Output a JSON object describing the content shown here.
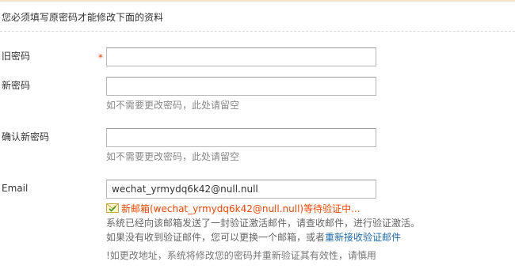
{
  "notice": "您必须填写原密码才能修改下面的资料",
  "fields": {
    "old_password": {
      "label": "旧密码",
      "required_mark": "*",
      "value": ""
    },
    "new_password": {
      "label": "新密码",
      "value": "",
      "hint": "如不需要更改密码，此处请留空"
    },
    "confirm_password": {
      "label": "确认新密码",
      "value": "",
      "hint": "如不需要更改密码，此处请留空"
    },
    "email": {
      "label": "Email",
      "value": "wechat_yrmydq6k42@null.null"
    }
  },
  "email_status": {
    "icon": "mail-check-icon",
    "pending": "新邮箱(wechat_yrmydq6k42@null.null)等待验证中...",
    "sent_info": "系统已经向该邮箱发送了一封验证激活邮件，请查收邮件，进行验证激活。",
    "not_received_prefix": "如果没有收到验证邮件，您可以更换一个邮箱，或者",
    "resend_link": "重新接收验证邮件",
    "warning": "!如更改地址，系统将修改您的密码并重新验证其有效性，请慎用"
  },
  "colors": {
    "required": "#ff3300",
    "pending": "#ff4400",
    "link": "#1f6bb0"
  }
}
